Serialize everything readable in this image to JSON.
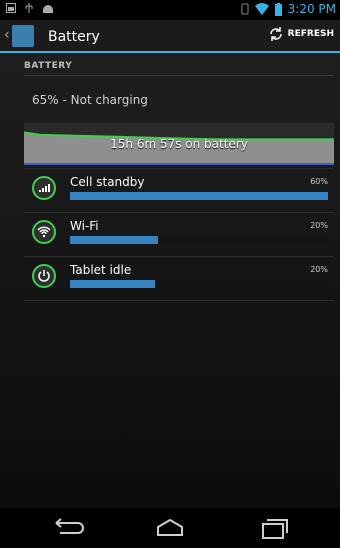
{
  "status_bar": {
    "time": "3:20 PM",
    "icons": [
      "screenshot-icon",
      "usb-icon",
      "android-icon",
      "vibrate-icon",
      "wifi-icon",
      "battery-icon"
    ]
  },
  "action_bar": {
    "title": "Battery",
    "refresh_label": "REFRESH"
  },
  "section": {
    "header": "BATTERY",
    "status": "65% - Not charging",
    "chart_label": "15h 6m 57s on battery"
  },
  "battery_level": {
    "start_percent": 78,
    "end_percent": 65
  },
  "usage": [
    {
      "name": "Cell standby",
      "percent_label": "60%",
      "fraction": 1.0,
      "icon": "signal-icon"
    },
    {
      "name": "Wi-Fi",
      "percent_label": "20%",
      "fraction": 0.34,
      "icon": "wifi-icon"
    },
    {
      "name": "Tablet idle",
      "percent_label": "20%",
      "fraction": 0.33,
      "icon": "power-icon"
    }
  ],
  "colors": {
    "accent": "#33b5e5",
    "bar_fill": "#3584c1",
    "battery_line": "#3ed04f",
    "chart_fill": "#8f8f8f"
  }
}
